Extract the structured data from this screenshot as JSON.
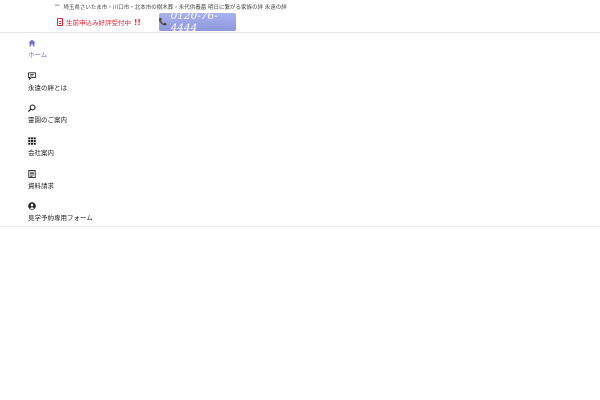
{
  "header": {
    "tagline": "埼玉県さいたま市・川口市・北本市の樹木葬・永代供養墓 明日に繋がる家族の絆 永遠の絆",
    "reservation_text": "生前申込み好評受付中",
    "reservation_mark": "!!",
    "phone_number": "0120-76-4444"
  },
  "nav": {
    "items": [
      {
        "label": "ホーム",
        "icon": "home-icon",
        "active": true
      },
      {
        "label": "永遠の絆とは",
        "icon": "speech-bubble-icon",
        "active": false
      },
      {
        "label": "霊園のご案内",
        "icon": "search-icon",
        "active": false
      },
      {
        "label": "会社案内",
        "icon": "grid-icon",
        "active": false
      },
      {
        "label": "資料請求",
        "icon": "document-icon",
        "active": false
      },
      {
        "label": "見学予約専用フォーム",
        "icon": "user-circle-icon",
        "active": false
      }
    ]
  },
  "colors": {
    "accent": "#6d73cc",
    "phone_button": "#9aa2e4",
    "reservation_red": "#dd2233"
  }
}
